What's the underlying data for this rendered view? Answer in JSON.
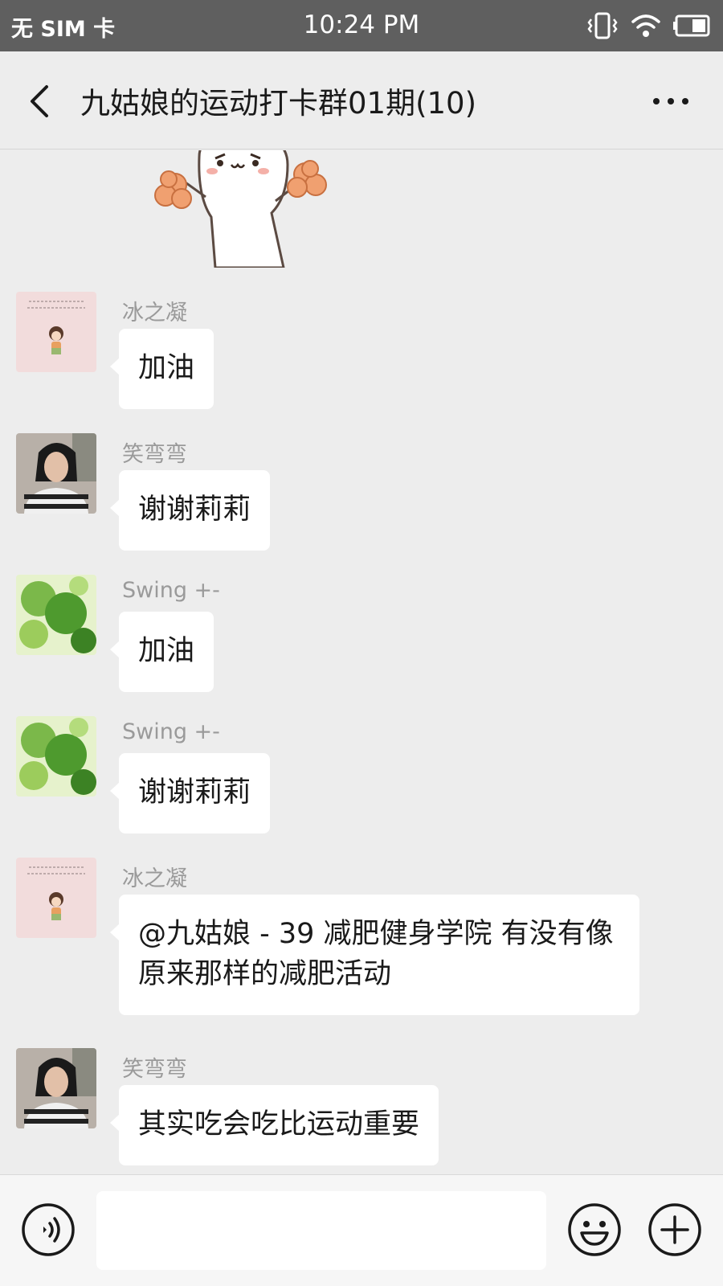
{
  "status_bar": {
    "carrier": "无 SIM 卡",
    "time": "10:24 PM",
    "icons": [
      "vibrate-icon",
      "wifi-icon",
      "battery-icon"
    ]
  },
  "header": {
    "title": "九姑娘的运动打卡群01期(10)",
    "back_icon": "chevron-left-icon",
    "more_icon": "more-dots-icon"
  },
  "messages": [
    {
      "sender": "冰之凝",
      "avatar": "cartoon-girl-avatar",
      "text": "加油"
    },
    {
      "sender": "笑弯弯",
      "avatar": "woman-photo-avatar",
      "text": "谢谢莉莉"
    },
    {
      "sender": "Swing +-",
      "avatar": "green-leaves-avatar",
      "text": "加油"
    },
    {
      "sender": "Swing +-",
      "avatar": "green-leaves-avatar",
      "text": "谢谢莉莉"
    },
    {
      "sender": "冰之凝",
      "avatar": "cartoon-girl-avatar",
      "text": "@九姑娘 - 39 减肥健身学院  有没有像原来那样的减肥活动"
    },
    {
      "sender": "笑弯弯",
      "avatar": "woman-photo-avatar",
      "text": "其实吃会吃比运动重要"
    }
  ],
  "input_bar": {
    "text_value": "",
    "icons": [
      "voice-icon",
      "emoji-icon",
      "plus-icon"
    ]
  },
  "colors": {
    "status_bar": "#5f5f5f",
    "background": "#ededed",
    "bubble": "#ffffff",
    "sender_name": "#9a9a9a"
  }
}
